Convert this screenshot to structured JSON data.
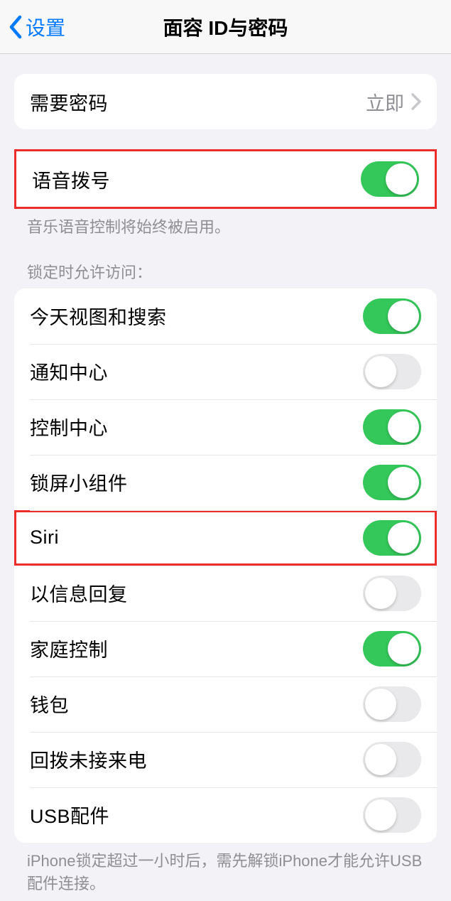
{
  "nav": {
    "back_label": "设置",
    "title": "面容 ID与密码"
  },
  "require_passcode": {
    "label": "需要密码",
    "value": "立即"
  },
  "voice_dial": {
    "label": "语音拨号",
    "footer": "音乐语音控制将始终被启用。",
    "enabled": true
  },
  "access_section": {
    "header": "锁定时允许访问：",
    "items": [
      {
        "label": "今天视图和搜索",
        "enabled": true
      },
      {
        "label": "通知中心",
        "enabled": false
      },
      {
        "label": "控制中心",
        "enabled": true
      },
      {
        "label": "锁屏小组件",
        "enabled": true
      },
      {
        "label": "Siri",
        "enabled": true,
        "highlighted": true
      },
      {
        "label": "以信息回复",
        "enabled": false
      },
      {
        "label": "家庭控制",
        "enabled": true
      },
      {
        "label": "钱包",
        "enabled": false
      },
      {
        "label": "回拨未接来电",
        "enabled": false
      },
      {
        "label": "USB配件",
        "enabled": false
      }
    ],
    "footer": "iPhone锁定超过一小时后，需先解锁iPhone才能允许USB 配件连接。"
  }
}
